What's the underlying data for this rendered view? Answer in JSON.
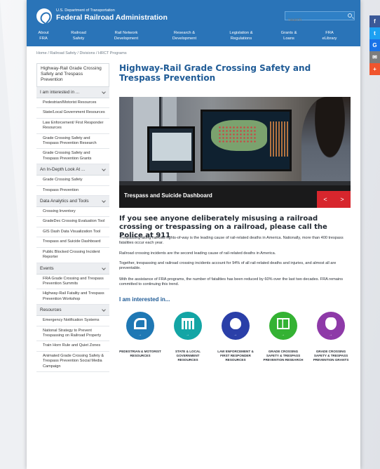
{
  "header": {
    "dept_label": "U.S. Department of Transportation",
    "agency_name": "Federal Railroad Administration",
    "search_placeholder": "Search",
    "nav": [
      {
        "line1": "About",
        "line2": "FRA"
      },
      {
        "line1": "Railroad",
        "line2": "Safety"
      },
      {
        "line1": "Rail Network",
        "line2": "Development"
      },
      {
        "line1": "Research &",
        "line2": "Development"
      },
      {
        "line1": "Legislation &",
        "line2": "Regulations"
      },
      {
        "line1": "Grants &",
        "line2": "Loans"
      },
      {
        "line1": "FRA",
        "line2": "eLibrary"
      }
    ]
  },
  "breadcrumb": "Home  /  Railroad Safety  /  Divisions  /  HRCT Programs",
  "sidebar": {
    "title": "Highway-Rail Grade Crossing Safety and Trespass Prevention",
    "sections": [
      {
        "label": "I am interested in ...",
        "items": [
          "Pedestrian/Motorist Resources",
          "State/Local Government Resources",
          "Law Enforcement/ First Responder Resources",
          "Grade Crossing Safety and Trespass Prevention Research",
          "Grade Crossing Safety and Trespass Prevention Grants"
        ]
      },
      {
        "label": "An In-Depth Look At ...",
        "items": [
          "Grade Crossing Safety",
          "Trespass Prevention"
        ]
      },
      {
        "label": "Data Analytics and Tools",
        "items": [
          "Crossing Inventory",
          "GradeDec Crossing Evaluation Tool",
          "GIS Dash Data Visualization Tool",
          "Trespass and Suicide Dashboard",
          "Public Blocked Crossing Incident Reporter"
        ]
      },
      {
        "label": "Events",
        "items": [
          "FRA Grade Crossing and Trespass Prevention Summits",
          "Highway-Rail Fatality and Trespass Prevention Workshop"
        ]
      },
      {
        "label": "Resources",
        "items": [
          "Emergency Notification Systems",
          "National Strategy to Prevent Trespassing on Railroad Property",
          "Train Horn Rule and Quiet Zones",
          "Animated Grade Crossing Safety & Trespass Prevention Social Media Campaign"
        ]
      }
    ]
  },
  "main": {
    "title": "Highway-Rail Grade Crossing Safety and Trespass Prevention",
    "hero_caption": "Trespass and Suicide Dashboard",
    "hero_prev": "<",
    "hero_next": ">",
    "callout": "If you see anyone deliberately misusing a railroad crossing or trespassing on a railroad, please call the Police at 911",
    "paragraphs": [
      "Trespassing along railroad rights-of-way is the leading cause of rail-related deaths in America. Nationally, more than 400 trespass fatalities occur each year.",
      "Railroad crossing incidents are the second leading cause of rail-related deaths in America.",
      "Together, trespassing and railroad crossing incidents account for 94% of all rail-related deaths and injuries, and almost all are preventable.",
      "With the assistance of FRA programs, the number of fatalities has been reduced by 60% over the last two decades. FRA remains committed to continuing this trend."
    ],
    "interest_heading": "I am interested in...",
    "interest_items": [
      {
        "label": "PEDESTRIAN & MOTORIST RESOURCES",
        "color": "#1f78b4",
        "icon": "pedestrian-car-icon"
      },
      {
        "label": "STATE & LOCAL GOVERNMENT RESOURCES",
        "color": "#13a5a5",
        "icon": "government-building-icon"
      },
      {
        "label": "LAW ENFORCEMENT & FIRST RESPONDER RESOURCES",
        "color": "#2a3fa8",
        "icon": "badge-icon"
      },
      {
        "label": "GRADE CROSSING SAFETY & TRESPASS PREVENTION RESEARCH",
        "color": "#34b233",
        "icon": "research-chart-icon"
      },
      {
        "label": "GRADE CROSSING SAFETY & TRESPASS PREVENTION GRANTS",
        "color": "#8e3aa8",
        "icon": "money-bag-icon"
      }
    ]
  },
  "social": [
    {
      "glyph": "f",
      "color": "#3b5998",
      "icon": "facebook-icon"
    },
    {
      "glyph": "t",
      "color": "#1da1f2",
      "icon": "twitter-icon"
    },
    {
      "glyph": "G",
      "color": "#1a73e8",
      "icon": "google-icon"
    },
    {
      "glyph": "✉",
      "color": "#7d7d7d",
      "icon": "email-icon"
    },
    {
      "glyph": "+",
      "color": "#f0552e",
      "icon": "share-more-icon"
    }
  ]
}
